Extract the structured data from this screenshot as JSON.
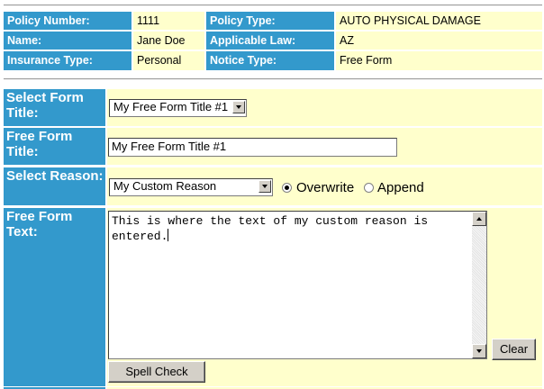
{
  "policy_info": {
    "policy_number_label": "Policy Number:",
    "policy_number_value": "1111",
    "policy_type_label": "Policy Type:",
    "policy_type_value": "AUTO PHYSICAL DAMAGE",
    "name_label": "Name:",
    "name_value": "Jane Doe",
    "applicable_law_label": "Applicable Law:",
    "applicable_law_value": "AZ",
    "insurance_type_label": "Insurance Type:",
    "insurance_type_value": "Personal",
    "notice_type_label": "Notice Type:",
    "notice_type_value": "Free Form"
  },
  "form": {
    "select_form_title_label": "Select Form Title:",
    "select_form_title_value": "My Free Form Title #1",
    "free_form_title_label": "Free Form Title:",
    "free_form_title_value": "My Free Form Title #1",
    "select_reason_label": "Select Reason:",
    "select_reason_value": "My Custom Reason",
    "overwrite_label": "Overwrite",
    "append_label": "Append",
    "radio_selected": "Overwrite",
    "free_form_text_label": "Free Form Text:",
    "free_form_text_value": "This is where the text of my custom reason is entered.",
    "clear_button": "Clear",
    "spell_check_button": "Spell Check"
  },
  "colors": {
    "label_bg": "#3399cc",
    "value_bg": "#ffffcc",
    "label_text": "#ffffff"
  }
}
